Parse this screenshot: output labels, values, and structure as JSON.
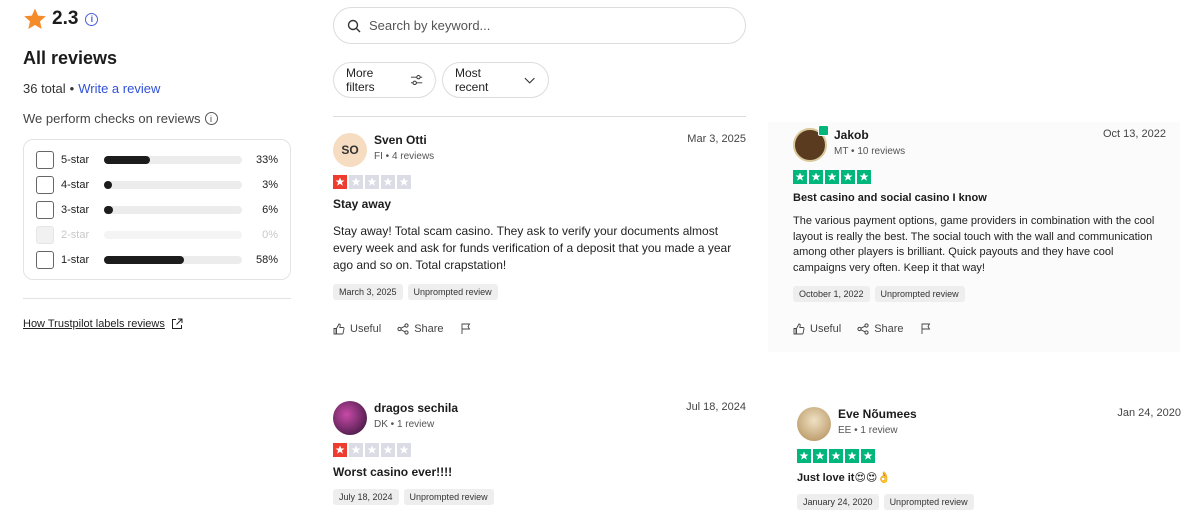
{
  "summary": {
    "rating": "2.3",
    "title": "All reviews",
    "total": "36 total",
    "separator": "•",
    "write_review": "Write a review",
    "checks_text": "We perform checks on reviews",
    "info_glyph": "i",
    "bars": [
      {
        "label": "5-star",
        "percent": "33%",
        "fill": 33
      },
      {
        "label": "4-star",
        "percent": "3%",
        "fill": 3
      },
      {
        "label": "3-star",
        "percent": "6%",
        "fill": 6
      },
      {
        "label": "2-star",
        "percent": "0%",
        "fill": 0
      },
      {
        "label": "1-star",
        "percent": "58%",
        "fill": 58
      }
    ],
    "labels_link": "How Trustpilot labels reviews"
  },
  "search": {
    "placeholder": "Search by keyword..."
  },
  "filters": {
    "more": "More filters",
    "sort": "Most recent"
  },
  "reviews": [
    {
      "initials": "SO",
      "name": "Sven Otti",
      "meta": "FI • 4 reviews",
      "date": "Mar 3, 2025",
      "stars": 1,
      "title": "Stay away",
      "body": "Stay away! Total scam casino. They ask to verify your documents almost every week and ask for funds verification of a deposit that you made a year ago and so on. Total crapstation!",
      "tag_date": "March 3, 2025",
      "tag_type": "Unprompted review",
      "useful": "Useful",
      "share": "Share"
    },
    {
      "name": "dragos sechila",
      "meta": "DK • 1 review",
      "date": "Jul 18, 2024",
      "stars": 1,
      "title": "Worst casino ever!!!!",
      "tag_date": "July 18, 2024",
      "tag_type": "Unprompted review"
    },
    {
      "name": "Jakob",
      "meta": "MT • 10 reviews",
      "date": "Oct 13, 2022",
      "stars": 5,
      "title": "Best casino and social casino I know",
      "body": "The various payment options, game providers in combination with the cool layout is really the best. The social touch with the wall and communication among other players is brilliant. Quick payouts and they have cool campaigns very often. Keep it that way!",
      "tag_date": "October 1, 2022",
      "tag_type": "Unprompted review",
      "useful": "Useful",
      "share": "Share"
    },
    {
      "name": "Eve Nõumees",
      "meta": "EE • 1 review",
      "date": "Jan 24, 2020",
      "stars": 5,
      "title": "Just love it😍😍👌",
      "tag_date": "January 24, 2020",
      "tag_type": "Unprompted review"
    }
  ],
  "colors": {
    "star_red": "#ee3c2f",
    "star_green": "#00b67a",
    "link": "#3050d8",
    "rating_star": "#f58c2a"
  },
  "icons": [
    "star-icon",
    "info-icon",
    "search-icon",
    "sliders-icon",
    "chevron-down-icon",
    "external-link-icon",
    "thumbs-up-icon",
    "share-icon",
    "flag-icon"
  ]
}
